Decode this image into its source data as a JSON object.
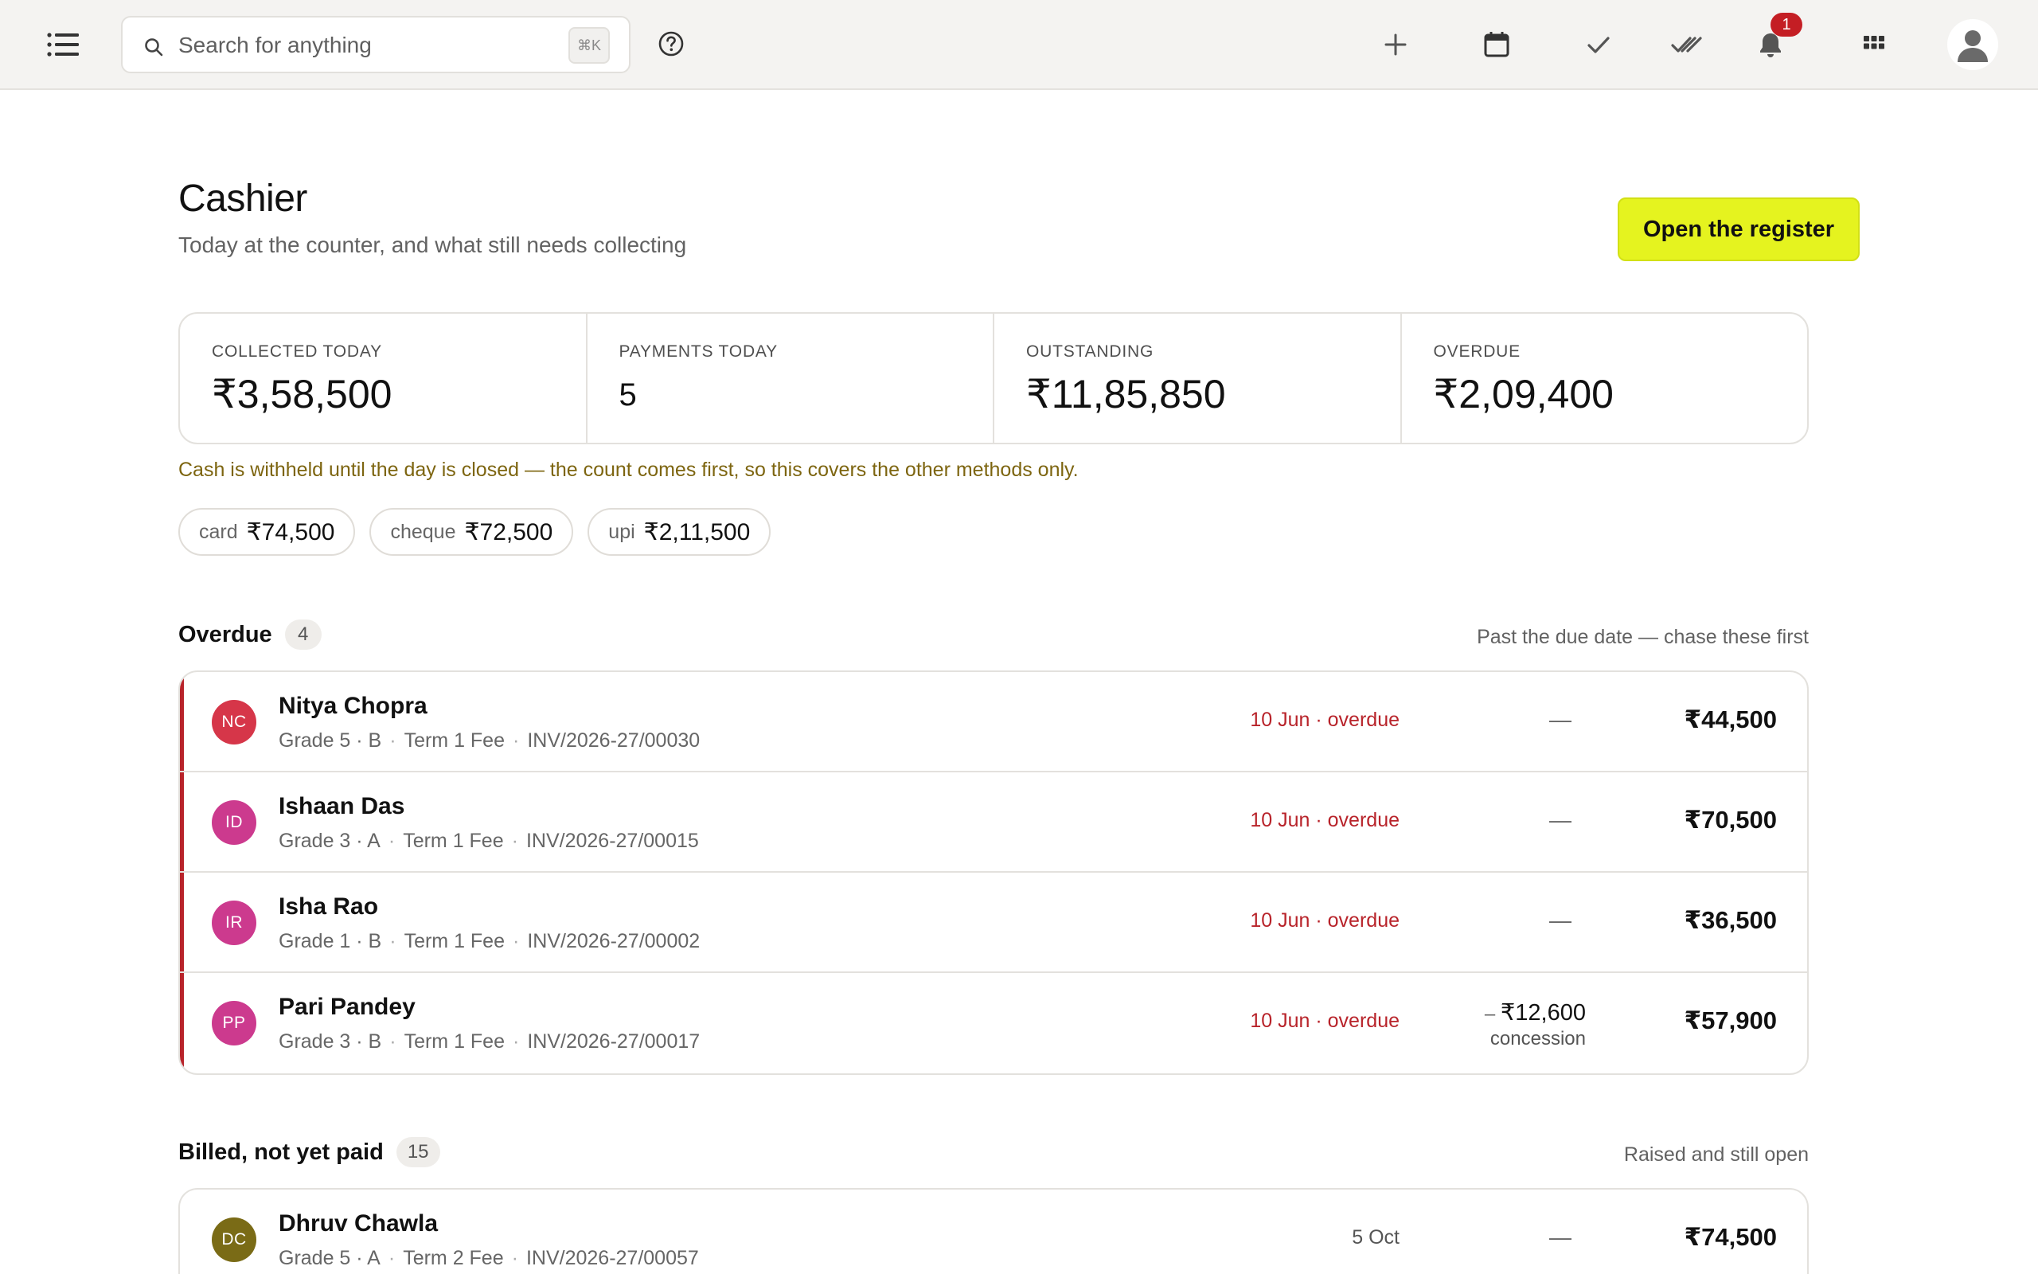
{
  "topbar": {
    "search_placeholder": "Search for anything",
    "shortcut": "⌘K",
    "notification_count": "1"
  },
  "header": {
    "title": "Cashier",
    "subtitle": "Today at the counter, and what still needs collecting",
    "primary_action": "Open the register"
  },
  "stats": [
    {
      "label": "COLLECTED TODAY",
      "value": "₹3,58,500"
    },
    {
      "label": "PAYMENTS TODAY",
      "value": "5"
    },
    {
      "label": "OUTSTANDING",
      "value": "₹11,85,850"
    },
    {
      "label": "OVERDUE",
      "value": "₹2,09,400"
    }
  ],
  "cash_note": "Cash is withheld until the day is closed — the count comes first, so this covers the other methods only.",
  "methods": [
    {
      "method": "card",
      "amount": "₹74,500"
    },
    {
      "method": "cheque",
      "amount": "₹72,500"
    },
    {
      "method": "upi",
      "amount": "₹2,11,500"
    }
  ],
  "overdue": {
    "title": "Overdue",
    "count": "4",
    "hint": "Past the due date — chase these first",
    "rows": [
      {
        "initials": "NC",
        "avatar_color": "#d63649",
        "name": "Nitya Chopra",
        "grade": "Grade 5 · B",
        "term": "Term 1 Fee",
        "invoice": "INV/2026-27/00030",
        "due": "10 Jun · overdue",
        "adjustment": "—",
        "amount": "₹44,500"
      },
      {
        "initials": "ID",
        "avatar_color": "#cc3a8e",
        "name": "Ishaan Das",
        "grade": "Grade 3 · A",
        "term": "Term 1 Fee",
        "invoice": "INV/2026-27/00015",
        "due": "10 Jun · overdue",
        "adjustment": "—",
        "amount": "₹70,500"
      },
      {
        "initials": "IR",
        "avatar_color": "#cc3a8e",
        "name": "Isha Rao",
        "grade": "Grade 1 · B",
        "term": "Term 1 Fee",
        "invoice": "INV/2026-27/00002",
        "due": "10 Jun · overdue",
        "adjustment": "—",
        "amount": "₹36,500"
      },
      {
        "initials": "PP",
        "avatar_color": "#cc3a8e",
        "name": "Pari Pandey",
        "grade": "Grade 3 · B",
        "term": "Term 1 Fee",
        "invoice": "INV/2026-27/00017",
        "due": "10 Jun · overdue",
        "adjustment_amount": "₹12,600",
        "adjustment_label": "concession",
        "amount": "₹57,900"
      }
    ]
  },
  "billed": {
    "title": "Billed, not yet paid",
    "count": "15",
    "hint": "Raised and still open",
    "rows": [
      {
        "initials": "DC",
        "avatar_color": "#7a6b16",
        "name": "Dhruv Chawla",
        "grade": "Grade 5 · A",
        "term": "Term 2 Fee",
        "invoice": "INV/2026-27/00057",
        "due": "5 Oct",
        "adjustment": "—",
        "amount": "₹74,500"
      }
    ]
  },
  "accent_color": "#e5f31f",
  "overdue_color": "#b8232a"
}
